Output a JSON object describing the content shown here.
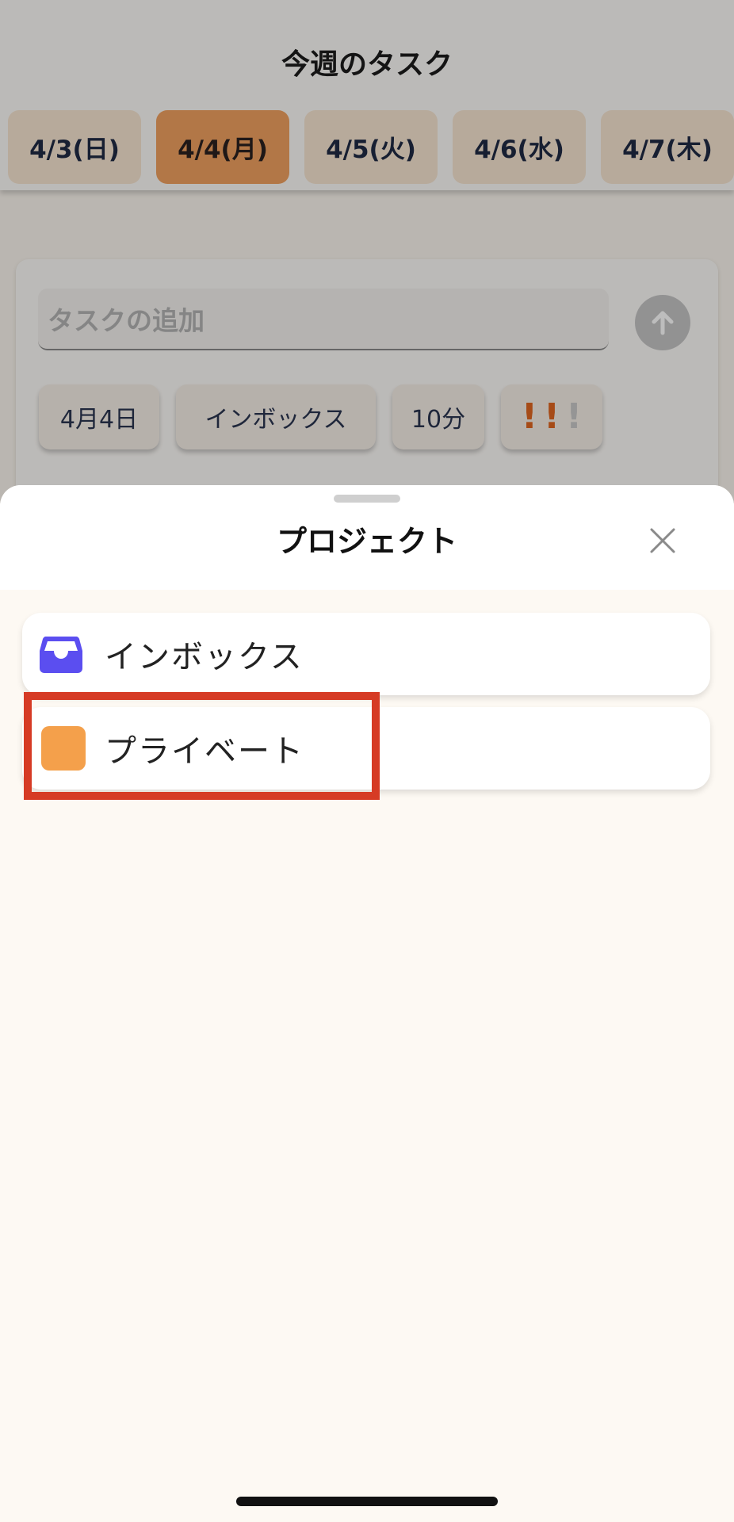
{
  "header": {
    "title": "今週のタスク",
    "date_tabs": [
      {
        "label": "4/3(日)",
        "active": false
      },
      {
        "label": "4/4(月)",
        "active": true
      },
      {
        "label": "4/5(火)",
        "active": false
      },
      {
        "label": "4/6(水)",
        "active": false
      },
      {
        "label": "4/7(木)",
        "active": false
      }
    ]
  },
  "add_task": {
    "placeholder": "タスクの追加",
    "date_chip": "4月4日",
    "project_chip": "インボックス",
    "duration_chip": "10分",
    "priority_marks": "!!!",
    "priority_level": 2,
    "priority_max": 3,
    "send_icon": "arrow-up-icon"
  },
  "sheet": {
    "title": "プロジェクト",
    "close_icon": "close-icon",
    "projects": [
      {
        "label": "インボックス",
        "icon": "inbox-tray-icon",
        "color": "#5b4ef0"
      },
      {
        "label": "プライベート",
        "icon": "color-swatch",
        "color": "#f4a04b"
      }
    ]
  },
  "colors": {
    "accent": "#f0a160",
    "priority_active": "#e0661f",
    "priority_inactive": "#c9c9c9",
    "highlight": "#d63b25"
  }
}
